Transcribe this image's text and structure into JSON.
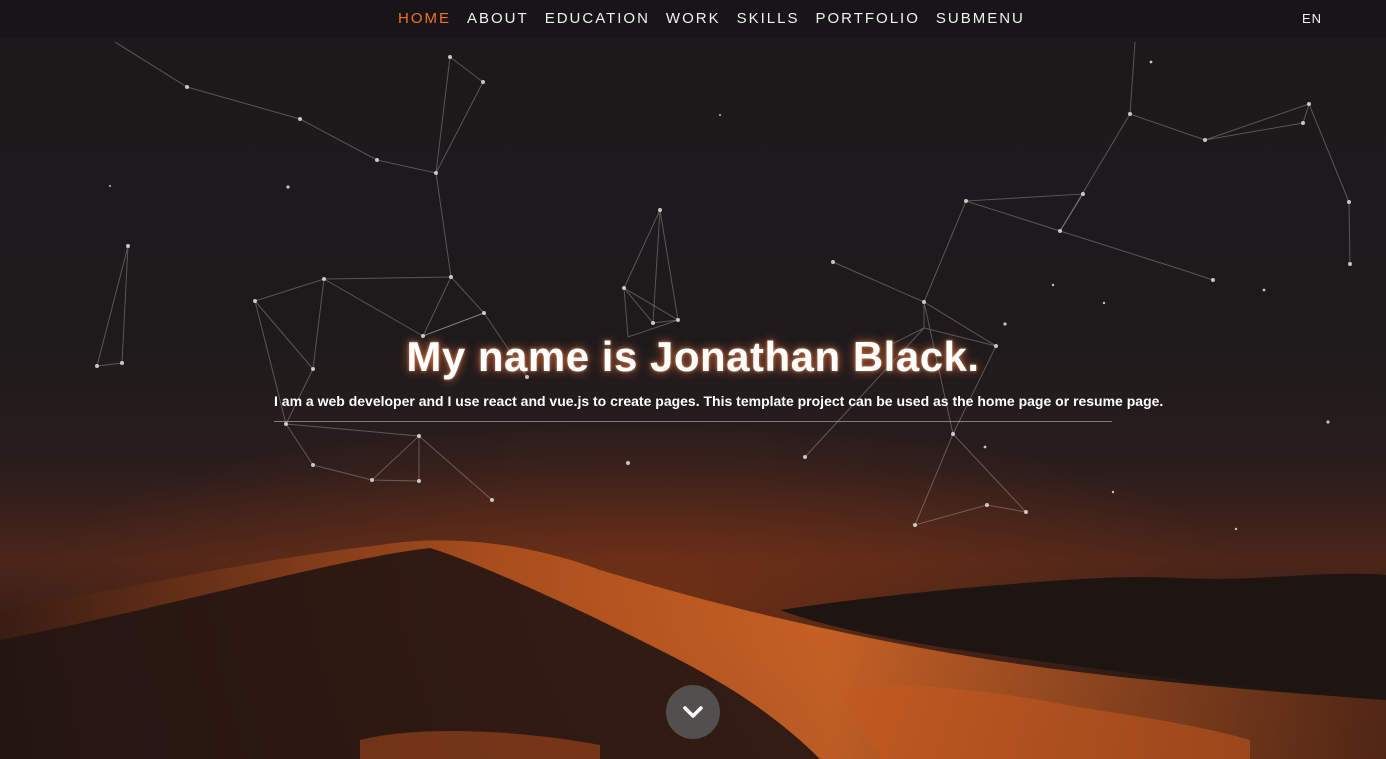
{
  "nav": {
    "items": [
      {
        "label": "HOME",
        "active": true
      },
      {
        "label": "ABOUT",
        "active": false
      },
      {
        "label": "EDUCATION",
        "active": false
      },
      {
        "label": "WORK",
        "active": false
      },
      {
        "label": "SKILLS",
        "active": false
      },
      {
        "label": "PORTFOLIO",
        "active": false
      },
      {
        "label": "SUBMENU",
        "active": false
      }
    ],
    "language": "EN"
  },
  "hero": {
    "title": "My name is Jonathan Black.",
    "subtitle": "I am a web developer and I use react and vue.js to create pages. This template project can be used as the home page or resume page."
  },
  "icons": {
    "scroll": "chevron-down-icon"
  },
  "colors": {
    "accent": "#f0712b",
    "nav_text": "#f1f1f1",
    "button_bg": "#555555"
  }
}
